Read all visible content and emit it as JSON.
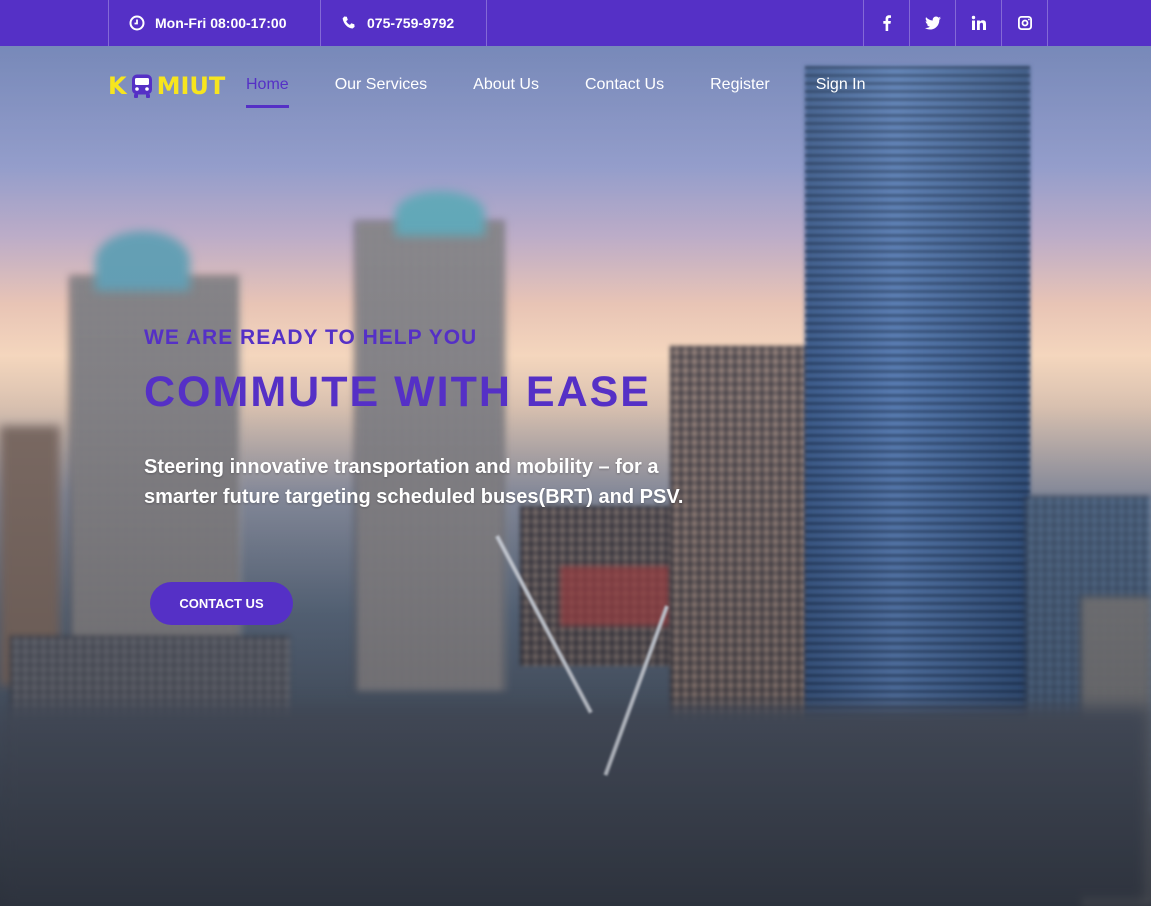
{
  "topbar": {
    "hours_icon": "clock-icon",
    "hours": "Mon-Fri 08:00-17:00",
    "phone_icon": "phone-icon",
    "phone": "075-759-9792",
    "socials": [
      "facebook-icon",
      "twitter-icon",
      "linkedin-icon",
      "instagram-icon"
    ]
  },
  "brand": {
    "logo_left": "K",
    "logo_icon": "bus-icon",
    "logo_right": "MIUT",
    "logo_color": "#f7e51e"
  },
  "nav": {
    "items": [
      {
        "label": "Home",
        "active": true
      },
      {
        "label": "Our Services",
        "active": false
      },
      {
        "label": "About Us",
        "active": false
      },
      {
        "label": "Contact Us",
        "active": false
      },
      {
        "label": "Register",
        "active": false
      },
      {
        "label": "Sign In",
        "active": false
      }
    ]
  },
  "hero": {
    "eyebrow": "WE ARE READY TO HELP YOU",
    "headline": "COMMUTE WITH EASE",
    "description": "Steering innovative transportation and mobility – for a smarter future targeting scheduled buses(BRT) and PSV.",
    "cta_label": "CONTACT US"
  },
  "colors": {
    "primary": "#5530c6",
    "accent": "#f7e51e",
    "text_light": "#ffffff"
  }
}
